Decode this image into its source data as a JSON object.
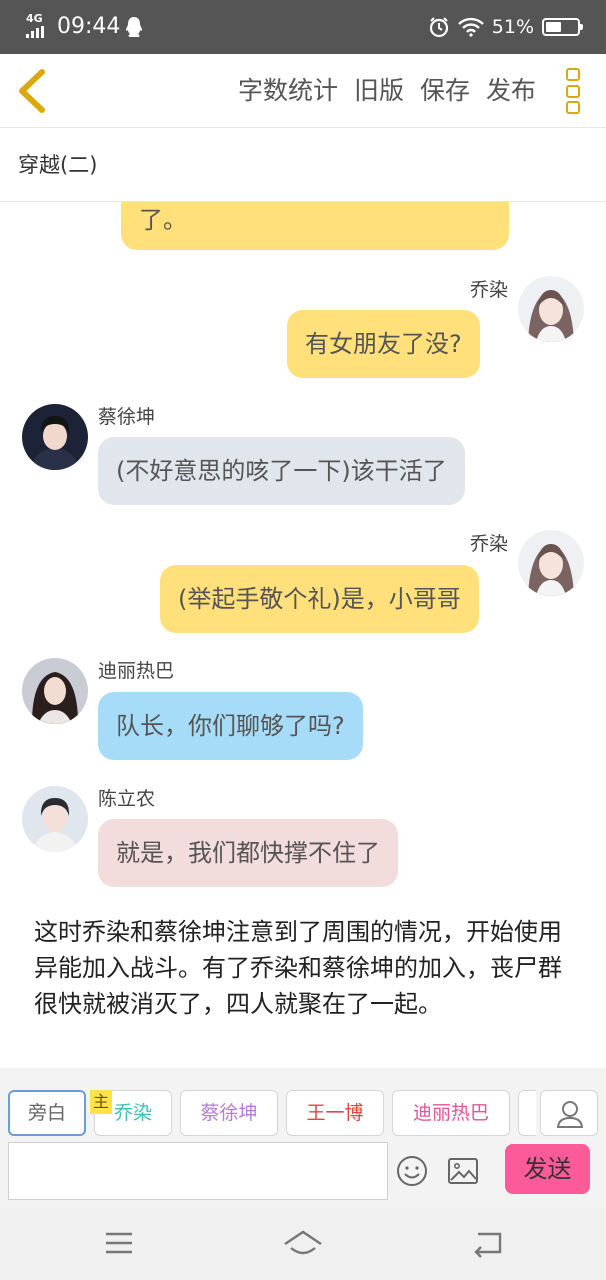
{
  "status_bar": {
    "network": "4G",
    "time": "09:44",
    "battery_text": "51%",
    "battery_level": 0.51
  },
  "toolbar": {
    "actions": [
      "字数统计",
      "旧版",
      "保存",
      "发布"
    ]
  },
  "chapter": {
    "title": "穿越(二)"
  },
  "messages": [
    {
      "side": "right",
      "name": "",
      "text": "了。",
      "color": "#ffe07a"
    },
    {
      "side": "right",
      "name": "乔染",
      "text": "有女朋友了没?",
      "color": "#ffe07a"
    },
    {
      "side": "left",
      "name": "蔡徐坤",
      "text": "(不好意思的咳了一下)该干活了",
      "color": "#e1e6ec"
    },
    {
      "side": "right",
      "name": "乔染",
      "text": "(举起手敬个礼)是，小哥哥",
      "color": "#ffe07a"
    },
    {
      "side": "left",
      "name": "迪丽热巴",
      "text": "队长，你们聊够了吗?",
      "color": "#a6dcf7"
    },
    {
      "side": "left",
      "name": "陈立农",
      "text": "就是，我们都快撑不住了",
      "color": "#f3dcdc"
    }
  ],
  "narration": "这时乔染和蔡徐坤注意到了周围的情况，开始使用异能加入战斗。有了乔染和蔡徐坤的加入，丧尸群很快就被消灭了，四人就聚在了一起。",
  "roles": [
    {
      "label": "旁白",
      "color": "#666666",
      "active": true
    },
    {
      "label": "乔染",
      "color": "#3cc0b8",
      "active": false
    },
    {
      "label": "蔡徐坤",
      "color": "#b57bd8",
      "active": false
    },
    {
      "label": "王一博",
      "color": "#e2473d",
      "active": false
    },
    {
      "label": "迪丽热巴",
      "color": "#e2559a",
      "active": false
    }
  ],
  "host_tag": "主",
  "composer": {
    "placeholder": "",
    "send_label": "发送"
  },
  "colors": {
    "accent": "#d9a90d",
    "send": "#fc5b9a",
    "active_role_border": "#6f9bd8"
  }
}
